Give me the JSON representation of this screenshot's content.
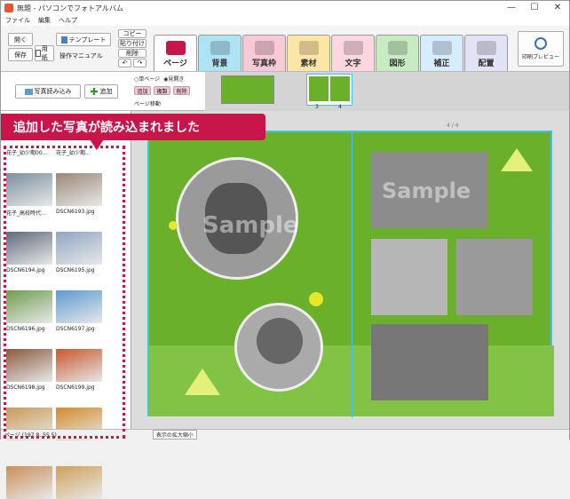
{
  "window": {
    "title": "無題 - パソコンでフォトアルバム",
    "minimize": "—",
    "maximize": "☐",
    "close": "✕"
  },
  "menu": [
    "ファイル",
    "編集",
    "ヘルプ"
  ],
  "toolbar": {
    "open": "開く",
    "save": "保存",
    "paper": "用紙",
    "template": "テンプレート",
    "manual": "操作マニュアル",
    "copy": "コピー",
    "paste": "貼り付け",
    "delete": "削除",
    "undo": "↶",
    "redo": "↷",
    "print_preview": "印刷プレビュー"
  },
  "tabs": [
    {
      "label": "ページ",
      "color": "#ffffff",
      "icon": "book-icon"
    },
    {
      "label": "背景",
      "color": "#aee3f3",
      "icon": "background-icon"
    },
    {
      "label": "写真枠",
      "color": "#f8c9d6",
      "icon": "photo-frame-icon"
    },
    {
      "label": "素材",
      "color": "#fde6a6",
      "icon": "material-icon"
    },
    {
      "label": "文字",
      "color": "#fcd6e1",
      "icon": "text-icon"
    },
    {
      "label": "図形",
      "color": "#c7ecc4",
      "icon": "shape-icon"
    },
    {
      "label": "補正",
      "color": "#d6ecff",
      "icon": "correction-icon"
    },
    {
      "label": "配置",
      "color": "#e3e3f7",
      "icon": "layout-icon"
    }
  ],
  "subbar": {
    "load_photos": "写真読み込み",
    "add": "追加",
    "single_page": "単ページ",
    "spread": "見開き",
    "btn_add": "追加",
    "btn_dup": "複製",
    "btn_del": "削除",
    "page_move": "ページ移動",
    "page_numbers": [
      "3",
      "4"
    ]
  },
  "callout": "追加した写真が読み込まれました",
  "page_indicator": "4 / 4",
  "photos": [
    {
      "name": "花子_幼少期00...",
      "color": "#7a8f9e"
    },
    {
      "name": "花子_幼少期...",
      "color": "#9a8878"
    },
    {
      "name": "花子_高校時代...",
      "color": "#5e6b7c"
    },
    {
      "name": "DSCN6193.jpg",
      "color": "#8fa6c2"
    },
    {
      "name": "DSCN6194.jpg",
      "color": "#6f9d4f"
    },
    {
      "name": "DSCN6195.jpg",
      "color": "#5d9ad0"
    },
    {
      "name": "DSCN6196.jpg",
      "color": "#8a5a3e"
    },
    {
      "name": "DSCN6197.jpg",
      "color": "#c8572a"
    },
    {
      "name": "DSCN6198.jpg",
      "color": "#c99a5a"
    },
    {
      "name": "DSCN6199.jpg",
      "color": "#d38a2a"
    },
    {
      "name": "",
      "color": "#c98f5a"
    },
    {
      "name": "",
      "color": "#d0a05a"
    }
  ],
  "watermark": "Sample",
  "status": {
    "page": "ページ (197.8, 55.5)",
    "zoom": "表示の拡大縮小"
  },
  "colors": {
    "accent": "#c7164a",
    "page_green": "#6ab02a",
    "frame_cyan": "#3ec5e0"
  }
}
